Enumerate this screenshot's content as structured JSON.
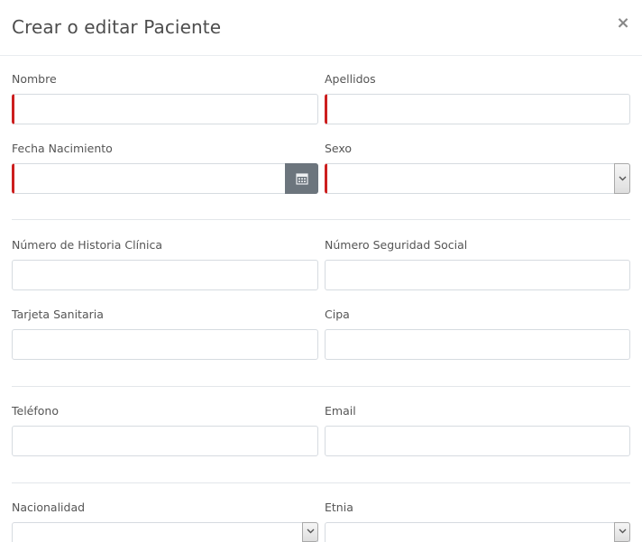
{
  "modal": {
    "title": "Crear o editar Paciente",
    "close_glyph": "×"
  },
  "fields": {
    "nombre": {
      "label": "Nombre",
      "value": "",
      "required": true
    },
    "apellidos": {
      "label": "Apellidos",
      "value": "",
      "required": true
    },
    "fecha_nacimiento": {
      "label": "Fecha Nacimiento",
      "value": "",
      "required": true,
      "button_icon": "calendar-icon"
    },
    "sexo": {
      "label": "Sexo",
      "value": "",
      "required": true,
      "icon": "chevron-down-icon"
    },
    "historia_clinica": {
      "label": "Número de Historia Clínica",
      "value": ""
    },
    "seguridad_social": {
      "label": "Número Seguridad Social",
      "value": ""
    },
    "tarjeta_sanitaria": {
      "label": "Tarjeta Sanitaria",
      "value": ""
    },
    "cipa": {
      "label": "Cipa",
      "value": ""
    },
    "telefono": {
      "label": "Teléfono",
      "value": ""
    },
    "email": {
      "label": "Email",
      "value": ""
    },
    "nacionalidad": {
      "label": "Nacionalidad",
      "value": "",
      "icon": "chevron-down-icon"
    },
    "etnia": {
      "label": "Etnia",
      "value": "",
      "icon": "chevron-down-icon"
    }
  },
  "colors": {
    "required_marker": "#cc1f1f",
    "calendar_button": "#6c757d",
    "input_border": "#d6dbe0"
  }
}
